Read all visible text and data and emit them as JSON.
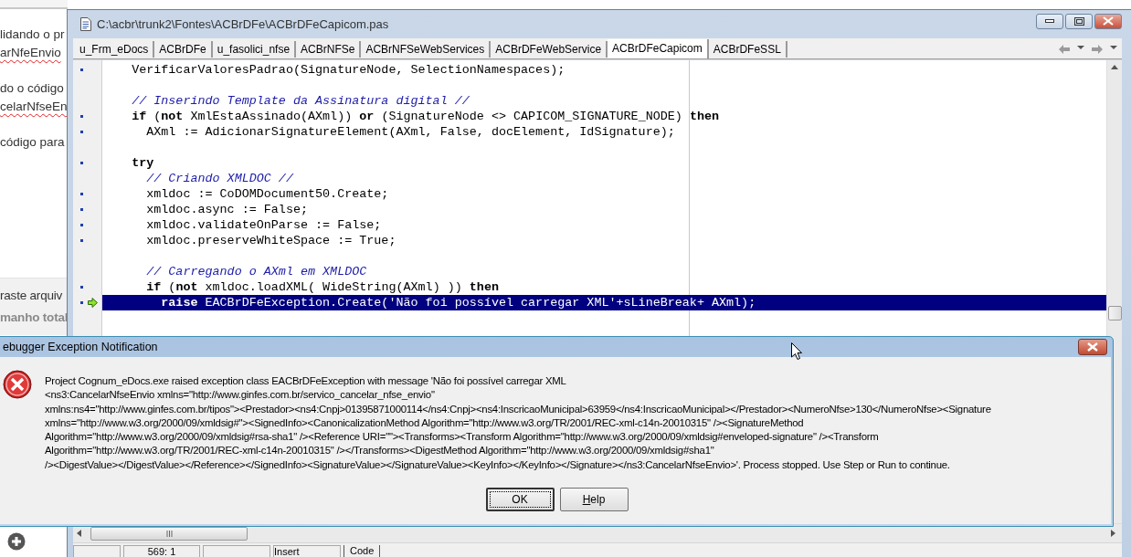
{
  "background_page": {
    "paragraphs": [
      {
        "lines": [
          {
            "text": "lidando o pr",
            "misspelled": false
          },
          {
            "text": "arNfeEnvio",
            "misspelled": true
          }
        ]
      },
      {
        "lines": [
          {
            "text": "do o código",
            "misspelled": false
          },
          {
            "text": "celarNfseEn",
            "misspelled": true
          }
        ]
      },
      {
        "lines": [
          {
            "text": "código para",
            "misspelled": false
          }
        ]
      }
    ],
    "panel_lines": [
      {
        "text": "raste arquiv",
        "kind": "normal"
      },
      {
        "text": "manho total",
        "kind": "bold"
      }
    ]
  },
  "editor": {
    "title": "C:\\acbr\\trunk2\\Fontes\\ACBrDFe\\ACBrDFeCapicom.pas",
    "tabs": [
      {
        "label": "u_Frm_eDocs",
        "selected": false
      },
      {
        "label": "ACBrDFe",
        "selected": false
      },
      {
        "label": "u_fasolici_nfse",
        "selected": false
      },
      {
        "label": "ACBrNFSe",
        "selected": false
      },
      {
        "label": "ACBrNFSeWebServices",
        "selected": false
      },
      {
        "label": "ACBrDFeWebService",
        "selected": false
      },
      {
        "label": "ACBrDFeCapicom",
        "selected": true
      },
      {
        "label": "ACBrDFeSSL",
        "selected": false
      }
    ],
    "code_lines": [
      {
        "space_before": false,
        "breakpoint": true,
        "execution_point": false,
        "selected": false,
        "tokens": [
          {
            "kind": "plain",
            "text": "    VerificarValoresPadrao(SignatureNode, SelectionNamespaces);"
          }
        ]
      },
      {
        "space_before": true,
        "breakpoint": false,
        "execution_point": false,
        "selected": false,
        "tokens": [
          {
            "kind": "comment",
            "text": "    // Inserindo Template da Assinatura digital //"
          }
        ]
      },
      {
        "space_before": false,
        "breakpoint": true,
        "execution_point": false,
        "selected": false,
        "tokens": [
          {
            "kind": "keyword",
            "text": "    if"
          },
          {
            "kind": "plain",
            "text": " ("
          },
          {
            "kind": "keyword",
            "text": "not"
          },
          {
            "kind": "plain",
            "text": " XmlEstaAssinado(AXml)) "
          },
          {
            "kind": "keyword",
            "text": "or"
          },
          {
            "kind": "plain",
            "text": " (SignatureNode <> CAPICOM_SIGNATURE_NODE) "
          },
          {
            "kind": "keyword",
            "text": "then"
          }
        ]
      },
      {
        "space_before": false,
        "breakpoint": true,
        "execution_point": false,
        "selected": false,
        "tokens": [
          {
            "kind": "plain",
            "text": "      AXml := AdicionarSignatureElement(AXml, False, docElement, IdSignature);"
          }
        ]
      },
      {
        "space_before": true,
        "breakpoint": true,
        "execution_point": false,
        "selected": false,
        "tokens": [
          {
            "kind": "keyword",
            "text": "    try"
          }
        ]
      },
      {
        "space_before": false,
        "breakpoint": false,
        "execution_point": false,
        "selected": false,
        "tokens": [
          {
            "kind": "comment",
            "text": "      // Criando XMLDOC //"
          }
        ]
      },
      {
        "space_before": false,
        "breakpoint": true,
        "execution_point": false,
        "selected": false,
        "tokens": [
          {
            "kind": "plain",
            "text": "      xmldoc := CoDOMDocument50.Create;"
          }
        ]
      },
      {
        "space_before": false,
        "breakpoint": true,
        "execution_point": false,
        "selected": false,
        "tokens": [
          {
            "kind": "plain",
            "text": "      xmldoc.async := False;"
          }
        ]
      },
      {
        "space_before": false,
        "breakpoint": true,
        "execution_point": false,
        "selected": false,
        "tokens": [
          {
            "kind": "plain",
            "text": "      xmldoc.validateOnParse := False;"
          }
        ]
      },
      {
        "space_before": false,
        "breakpoint": true,
        "execution_point": false,
        "selected": false,
        "tokens": [
          {
            "kind": "plain",
            "text": "      xmldoc.preserveWhiteSpace := True;"
          }
        ]
      },
      {
        "space_before": true,
        "breakpoint": false,
        "execution_point": false,
        "selected": false,
        "tokens": [
          {
            "kind": "comment",
            "text": "      // Carregando o AXml em XMLDOC"
          }
        ]
      },
      {
        "space_before": false,
        "breakpoint": true,
        "execution_point": false,
        "selected": false,
        "tokens": [
          {
            "kind": "keyword",
            "text": "      if"
          },
          {
            "kind": "plain",
            "text": " ("
          },
          {
            "kind": "keyword",
            "text": "not"
          },
          {
            "kind": "plain",
            "text": " xmldoc.loadXML( WideString(AXml) )) "
          },
          {
            "kind": "keyword",
            "text": "then"
          }
        ]
      },
      {
        "space_before": false,
        "breakpoint": true,
        "execution_point": true,
        "selected": true,
        "tokens": [
          {
            "kind": "keyword",
            "text": "        raise"
          },
          {
            "kind": "plain",
            "text": " EACBrDFeException.Create("
          },
          {
            "kind": "string",
            "text": "'Não foi possível carregar XML'"
          },
          {
            "kind": "plain",
            "text": "+sLineBreak+ AXml);"
          }
        ]
      }
    ],
    "status_bar": {
      "position": "569: 1",
      "mode": "Insert",
      "view_tab": "Code"
    }
  },
  "dialog": {
    "title": "ebugger Exception Notification",
    "message": "Project Cognum_eDocs.exe raised exception class EACBrDFeException with message 'Não foi possível carregar XML\n<ns3:CancelarNfseEnvio xmlns=\"http://www.ginfes.com.br/servico_cancelar_nfse_envio\"\nxmlns:ns4=\"http://www.ginfes.com.br/tipos\"><Prestador><ns4:Cnpj>01395871000114</ns4:Cnpj><ns4:InscricaoMunicipal>63959</ns4:InscricaoMunicipal></Prestador><NumeroNfse>130</NumeroNfse><Signature\nxmlns=\"http://www.w3.org/2000/09/xmldsig#\"><SignedInfo><CanonicalizationMethod Algorithm=\"http://www.w3.org/TR/2001/REC-xml-c14n-20010315\" /><SignatureMethod\nAlgorithm=\"http://www.w3.org/2000/09/xmldsig#rsa-sha1\" /><Reference URI=\"\"><Transforms><Transform Algorithm=\"http://www.w3.org/2000/09/xmldsig#enveloped-signature\" /><Transform\nAlgorithm=\"http://www.w3.org/TR/2001/REC-xml-c14n-20010315\" /></Transforms><DigestMethod Algorithm=\"http://www.w3.org/2000/09/xmldsig#sha1\"\n/><DigestValue></DigestValue></Reference></SignedInfo><SignatureValue></SignatureValue><KeyInfo></KeyInfo></Signature></ns3:CancelarNfseEnvio>'. Process stopped. Use Step or Run to continue.",
    "buttons": [
      {
        "label": "OK",
        "default": true,
        "access_key_underlined": false
      },
      {
        "label": "Help",
        "default": false,
        "access_key_underlined": true
      }
    ]
  }
}
